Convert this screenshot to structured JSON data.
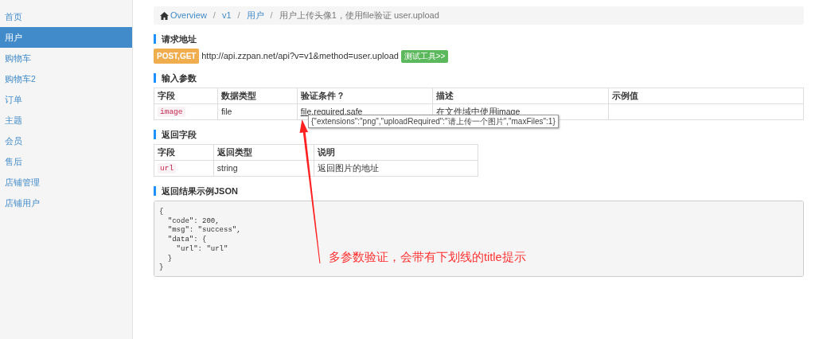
{
  "sidebar": {
    "items": [
      {
        "label": "首页",
        "selected": false
      },
      {
        "label": "用户",
        "selected": true
      },
      {
        "label": "购物车",
        "selected": false
      },
      {
        "label": "购物车2",
        "selected": false
      },
      {
        "label": "订单",
        "selected": false
      },
      {
        "label": "主题",
        "selected": false
      },
      {
        "label": "会员",
        "selected": false
      },
      {
        "label": "售后",
        "selected": false
      },
      {
        "label": "店铺管理",
        "selected": false
      },
      {
        "label": "店铺用户",
        "selected": false
      }
    ]
  },
  "breadcrumb": {
    "separator": "/",
    "items": [
      {
        "label": "Overview",
        "kind": "link"
      },
      {
        "label": "v1",
        "kind": "link"
      },
      {
        "label": "用户",
        "kind": "link"
      },
      {
        "label": "用户上传头像1，使用file验证 user.upload",
        "kind": "current"
      }
    ]
  },
  "request": {
    "heading": "请求地址",
    "method": "POST,GET",
    "url": "http://api.zzpan.net/api?v=v1&method=user.upload",
    "test_button": "测试工具>>"
  },
  "input_params": {
    "heading": "输入参数",
    "columns": [
      "字段",
      "数据类型",
      "验证条件 ?",
      "描述",
      "示例值"
    ],
    "rows": [
      {
        "field": "image",
        "type": "file",
        "rule_abbr": "file",
        "rule_rest": ",required,safe",
        "description": "在文件域中使用image"
      }
    ],
    "tooltip": "{\"extensions\":\"png\",\"uploadRequired\":\"请上传一个图片\",\"maxFiles\":1}"
  },
  "return_fields": {
    "heading": "返回字段",
    "columns": [
      "字段",
      "返回类型",
      "说明"
    ],
    "rows": [
      {
        "field": "url",
        "type": "string",
        "description": "返回图片的地址"
      }
    ]
  },
  "example_json": {
    "heading": "返回结果示例JSON",
    "lines": [
      "{",
      "  \"code\": 200,",
      "  \"msg\": \"success\",",
      "  \"data\": {",
      "    \"url\": \"url\"",
      "  }",
      "}"
    ]
  },
  "annotation": {
    "text": "多参数验证，会带有下划线的title提示"
  }
}
